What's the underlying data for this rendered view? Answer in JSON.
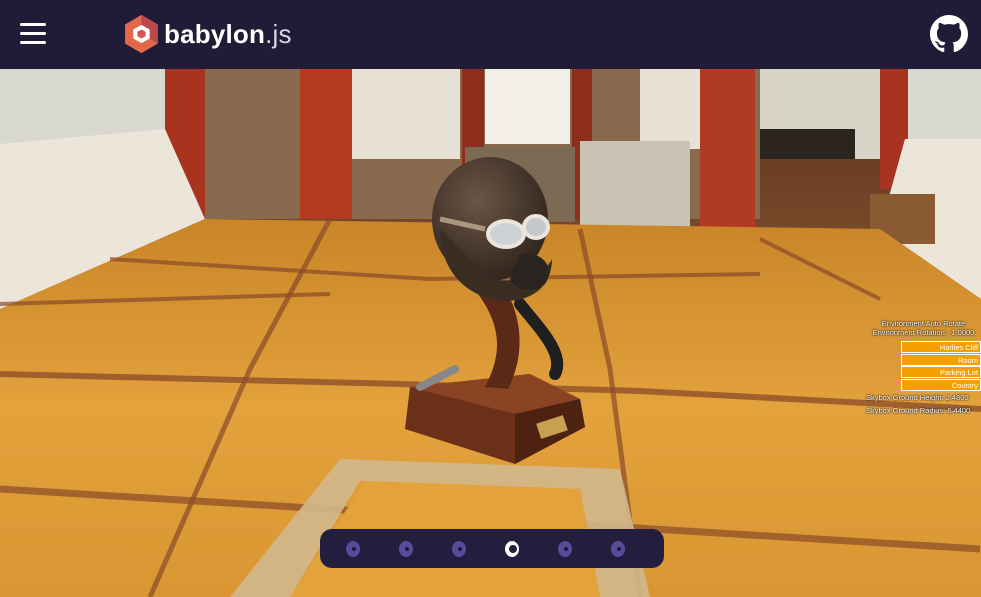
{
  "header": {
    "logo_name": "babylon",
    "logo_ext": ".js",
    "menu_icon": "hamburger-menu-icon",
    "github_icon": "github-icon",
    "logo_color": "#e0684b"
  },
  "scene": {
    "subject": "aviator helmet on display stand",
    "colors": {
      "floor": "#e0a03a",
      "wall": "#8b4a24",
      "gui_button": "#f5a000"
    }
  },
  "gui": {
    "auto_rotate_label": "Environment Auto Rotate",
    "rotation_label": "Environment Rotation: -1.0000",
    "buttons": [
      "Harlies Cliff",
      "Room",
      "Parking Lot",
      "Country"
    ],
    "ground_height_label": "Skybox Ground Height: 2.4800",
    "ground_radius_label": "Skybox Ground Radius: 6.4400"
  },
  "pager": {
    "count": 6,
    "active_index": 3
  }
}
